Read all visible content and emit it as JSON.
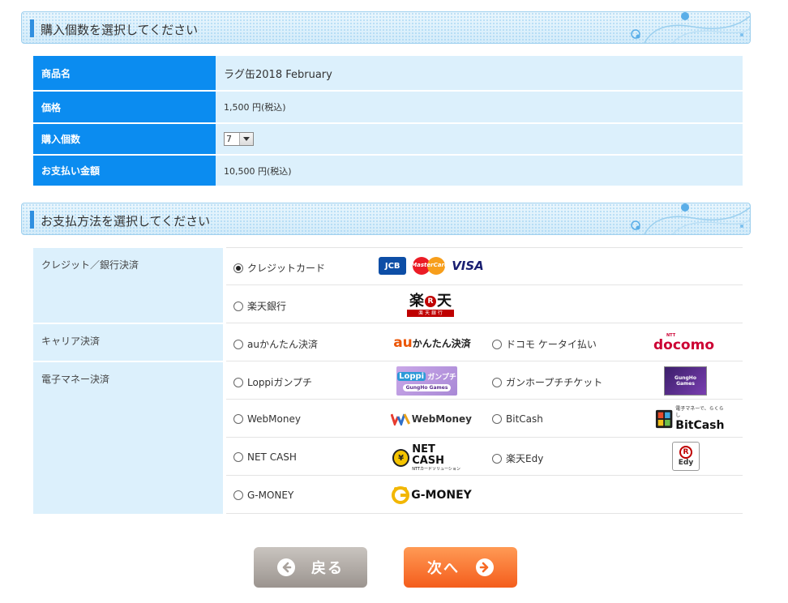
{
  "sections": {
    "quantity_title": "購入個数を選択してください",
    "payment_title": "お支払方法を選択してください"
  },
  "order": {
    "product_label": "商品名",
    "product_value": "ラグ缶2018 February",
    "price_label": "価格",
    "price_value": "1,500 円(税込)",
    "quantity_label": "購入個数",
    "quantity_value": "7",
    "total_label": "お支払い金額",
    "total_value": "10,500 円(税込)"
  },
  "payment": {
    "categories": {
      "credit": "クレジット／銀行決済",
      "carrier": "キャリア決済",
      "emoney": "電子マネー決済"
    },
    "options": {
      "credit_card": "クレジットカード",
      "rakuten_bank": "楽天銀行",
      "au": "auかんたん決済",
      "docomo": "ドコモ ケータイ払い",
      "loppi": "Loppiガンプチ",
      "gungho": "ガンホープチチケット",
      "webmoney": "WebMoney",
      "bitcash": "BitCash",
      "netcash": "NET CASH",
      "edy": "楽天Edy",
      "gmoney": "G-MONEY"
    },
    "selected": "credit_card",
    "logo_text": {
      "jcb": "JCB",
      "mastercard": "MasterCard",
      "visa": "VISA",
      "rakuten_left": "楽",
      "rakuten_right": "天",
      "rakuten_sub": "楽 天 銀 行",
      "au_a": "au",
      "au_b": "かんたん決済",
      "docomo": "docomo",
      "docomo_ntt": "NTT",
      "loppi_a": "Loppi",
      "loppi_b": "ガンプチ",
      "loppi_c": "GungHo Games",
      "gungho": "GungHo Games",
      "webmoney": "WebMoney",
      "bitcash_tag": "電子マネーで、らくらし",
      "bitcash": "BitCash",
      "netcash": "NET CASH",
      "netcash_sub": "NTTカードソリューション",
      "edy_r": "R",
      "edy": "Edy",
      "gmoney": "G-MONEY"
    }
  },
  "buttons": {
    "back": "戻る",
    "next": "次へ"
  },
  "colors": {
    "header_blue": "#0b8cf0",
    "row_bg": "#dcf0fc",
    "back_button": "#a9a29c",
    "next_button": "#f76a25"
  }
}
